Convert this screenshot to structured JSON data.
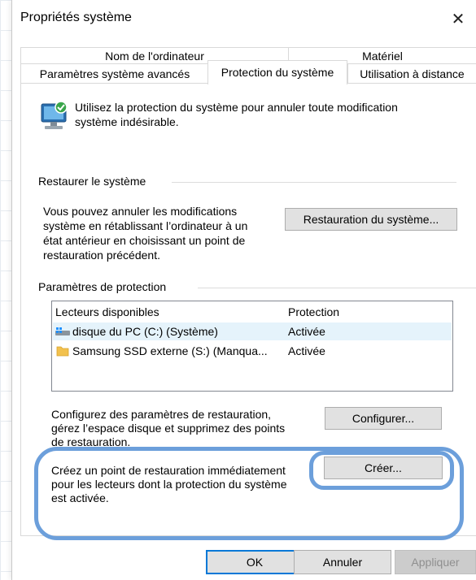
{
  "window": {
    "title": "Propriétés système",
    "close_glyph": "✕"
  },
  "tabs": {
    "back_row": [
      "Nom de l'ordinateur",
      "Matériel"
    ],
    "front_row": [
      "Paramètres système avancés",
      "Protection du système",
      "Utilisation à distance"
    ],
    "selected": "Protection du système"
  },
  "intro": {
    "icon": "system-protection-icon",
    "text_line1": "Utilisez la protection du système pour annuler toute modification",
    "text_line2": "système indésirable."
  },
  "restore": {
    "group_label": "Restaurer le système",
    "desc_line1": "Vous pouvez annuler les modifications",
    "desc_line2": "système en rétablissant l’ordinateur à un",
    "desc_line3": "état antérieur en choisissant un point de",
    "desc_line4": "restauration précédent.",
    "button_label": "Restauration du système..."
  },
  "protection": {
    "group_label": "Paramètres de protection",
    "columns": [
      "Lecteurs disponibles",
      "Protection"
    ],
    "rows": [
      {
        "icon": "windows-drive-icon",
        "drive": "disque du PC (C:) (Système)",
        "status": "Activée"
      },
      {
        "icon": "folder-icon",
        "drive": "Samsung SSD externe (S:) (Manqua...",
        "status": "Activée"
      }
    ],
    "configure_line1": "Configurez des paramètres de restauration,",
    "configure_line2": "gérez l’espace disque et supprimez des points",
    "configure_line3": "de restauration.",
    "configure_button": "Configurer...",
    "create_line1": "Créez un point de restauration immédiatement",
    "create_line2": "pour les lecteurs dont la protection du système",
    "create_line3": "est activée.",
    "create_button": "Créer..."
  },
  "footer": {
    "ok": "OK",
    "cancel": "Annuler",
    "apply": "Appliquer"
  },
  "colors": {
    "accent": "#0078d7",
    "highlight_annotation": "#6c9fdb",
    "selected_row": "#e5f3fb"
  }
}
